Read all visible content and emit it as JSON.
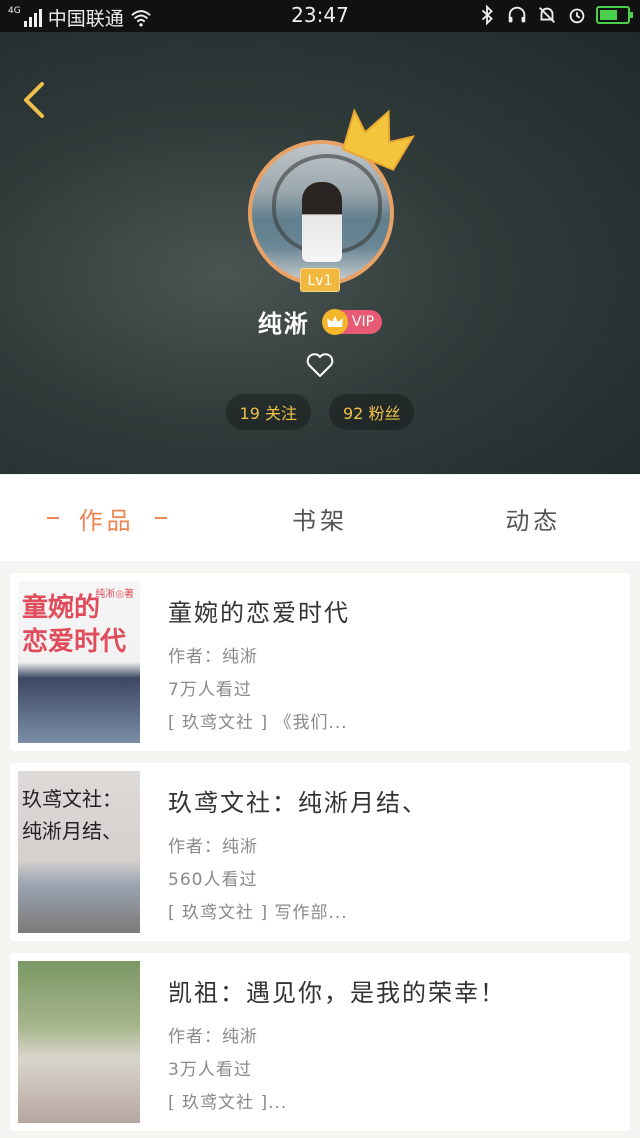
{
  "status_bar": {
    "network_type": "4G",
    "carrier": "中国联通",
    "time": "23:47"
  },
  "profile": {
    "username": "纯淅",
    "vip_label": "VIP",
    "level": "Lv1",
    "following": "19 关注",
    "followers": "92 粉丝"
  },
  "tabs": [
    {
      "label": "作品",
      "active": true
    },
    {
      "label": "书架",
      "active": false
    },
    {
      "label": "动态",
      "active": false
    }
  ],
  "books": [
    {
      "title": "童婉的恋爱时代",
      "author": "作者：纯淅",
      "views": "7万人看过",
      "tags": "[ 玖鸢文社 ] 《我们...",
      "cover_text": "童婉的\n恋爱时代",
      "cover_tag": "纯淅◎著"
    },
    {
      "title": "玖鸢文社：纯淅月结、",
      "author": "作者：纯淅",
      "views": "560人看过",
      "tags": "[ 玖鸢文社 ] 写作部...",
      "cover_text": "玖鸢文社：\n纯淅月结、"
    },
    {
      "title": "凯祖：遇见你，是我的荣幸！",
      "author": "作者：纯淅",
      "views": "3万人看过",
      "tags": "[ 玖鸢文社 ]..."
    }
  ],
  "colors": {
    "accent": "#ef8552",
    "stat_text": "#f0c14a",
    "vip_bg": "#e75a74",
    "level_bg": "#f1b840"
  }
}
